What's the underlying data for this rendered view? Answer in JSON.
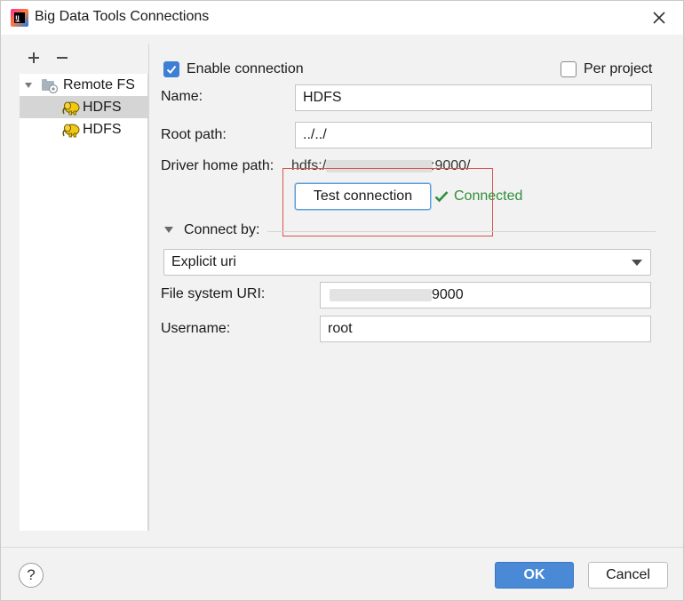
{
  "window": {
    "title": "Big Data Tools Connections"
  },
  "left_panel": {
    "add_label": "+",
    "remove_label": "−",
    "tree": {
      "root_label": "Remote FS",
      "items": [
        {
          "label": "HDFS",
          "selected": true
        },
        {
          "label": "HDFS",
          "selected": false
        }
      ]
    }
  },
  "form": {
    "enable_connection": {
      "label": "Enable connection",
      "checked": true
    },
    "per_project": {
      "label": "Per project",
      "checked": false
    },
    "name": {
      "label": "Name:",
      "value": "HDFS"
    },
    "root_path": {
      "label": "Root path:",
      "value": "../../"
    },
    "driver_home_path": {
      "label": "Driver home path:",
      "value_prefix": "hdfs:/",
      "value_suffix": ":9000/"
    },
    "test_connection_label": "Test connection",
    "status_text": "Connected",
    "connect_by": {
      "label": "Connect by:",
      "selected": "Explicit uri"
    },
    "file_system_uri": {
      "label": "File system URI:",
      "value_suffix": "9000"
    },
    "username": {
      "label": "Username:",
      "value": "root"
    }
  },
  "footer": {
    "help_label": "?",
    "ok_label": "OK",
    "cancel_label": "Cancel"
  },
  "colors": {
    "accent": "#4a89d6",
    "checkbox": "#3d7fd4",
    "success": "#2f8f3a",
    "highlight_box": "#d9534f",
    "hdfs_icon": "#f2c811"
  }
}
